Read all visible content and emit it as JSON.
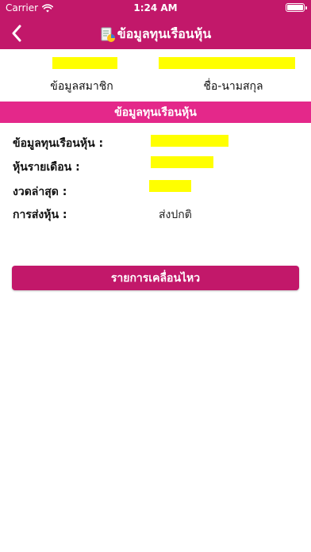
{
  "status_bar": {
    "carrier": "Carrier",
    "time": "1:24 AM",
    "icons": [
      "wifi-icon",
      "battery-icon"
    ]
  },
  "nav": {
    "title": "ข้อมูลทุนเรือนหุ้น",
    "back_icon": "chevron-left-icon",
    "title_icon": "document-chart-icon"
  },
  "member": {
    "member_info_label": "ข้อมูลสมาชิก",
    "name_label": "ชื่อ-นามสกุล"
  },
  "section": {
    "title": "ข้อมูลทุนเรือนหุ้น"
  },
  "details": [
    {
      "label": "ข้อมูลทุนเรือนหุ้น :",
      "value": ""
    },
    {
      "label": "หุ้นรายเดือน :",
      "value": ""
    },
    {
      "label": "งวดล่าสุด :",
      "value": ""
    },
    {
      "label": "การส่งหุ้น :",
      "value": "ส่งปกติ"
    }
  ],
  "actions": {
    "movement_button": "รายการเคลื่อนไหว"
  },
  "colors": {
    "header": "#c2186a",
    "section_bar": "#e4288a",
    "button": "#c2186a",
    "redaction_highlight": "#ffff00"
  }
}
